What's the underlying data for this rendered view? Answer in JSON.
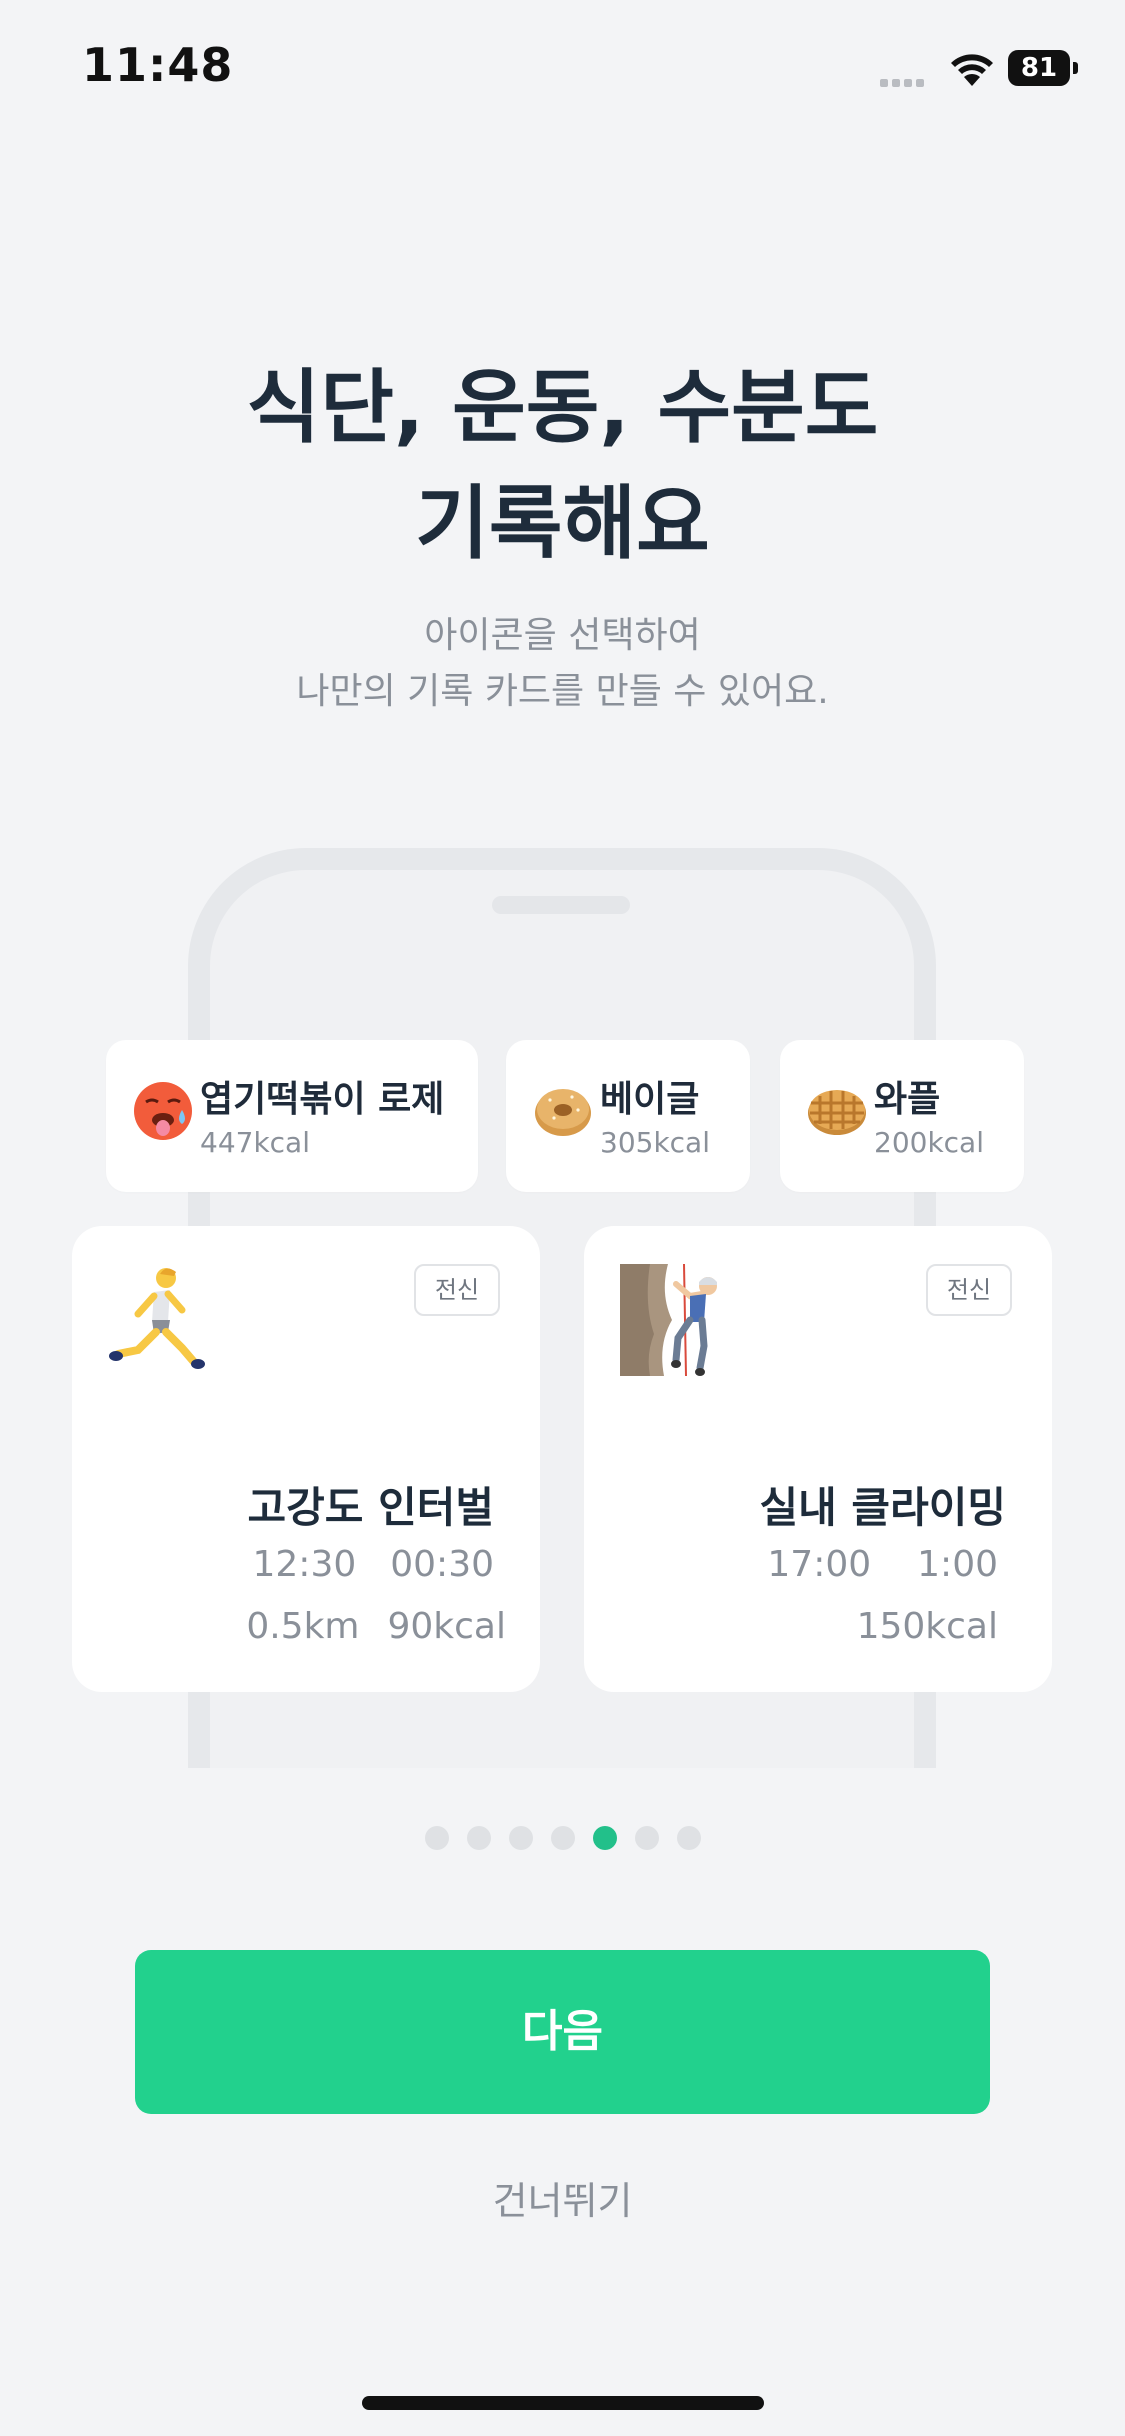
{
  "status_bar": {
    "time": "11:48",
    "battery": "81"
  },
  "headline": {
    "line1": "식단, 운동, 수분도",
    "line2": "기록해요"
  },
  "description": {
    "line1": "아이콘을 선택하여",
    "line2": "나만의 기록 카드를 만들 수 있어요."
  },
  "food_cards": [
    {
      "name": "엽기떡볶이 로제",
      "kcal": "447kcal",
      "icon": "hot-face-emoji"
    },
    {
      "name": "베이글",
      "kcal": "305kcal",
      "icon": "bagel-emoji"
    },
    {
      "name": "와플",
      "kcal": "200kcal",
      "icon": "waffle-emoji"
    }
  ],
  "exercise_cards": [
    {
      "name": "고강도 인터벌",
      "tag": "전신",
      "start": "12:30",
      "duration": "00:30",
      "distance": "0.5km",
      "kcal": "90kcal",
      "icon": "running-person-emoji"
    },
    {
      "name": "실내 클라이밍",
      "tag": "전신",
      "start": "17:00",
      "duration": "1:00",
      "kcal": "150kcal",
      "icon": "climbing-person-emoji"
    }
  ],
  "pager": {
    "total": 7,
    "active_index": 4
  },
  "buttons": {
    "next": "다음",
    "skip": "건너뛰기"
  },
  "colors": {
    "accent": "#22d18d",
    "title": "#1e2c3b",
    "muted": "#8a9099",
    "background": "#f3f4f6"
  }
}
